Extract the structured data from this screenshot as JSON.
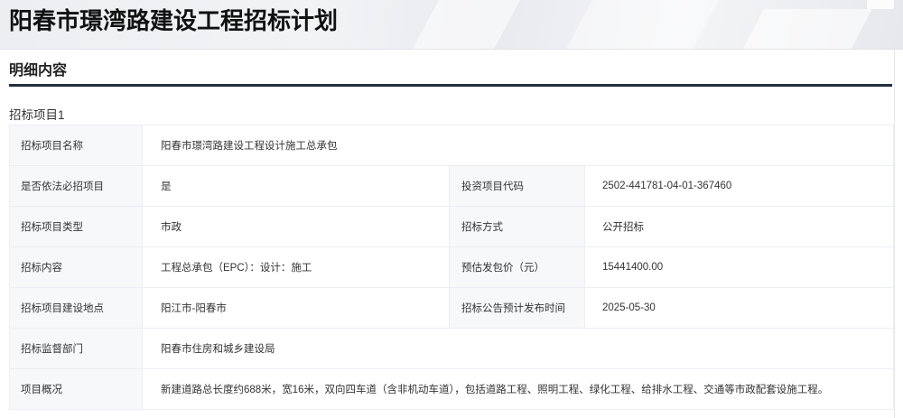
{
  "page": {
    "title": "阳春市璟湾路建设工程招标计划"
  },
  "section": {
    "heading": "明细内容"
  },
  "project": {
    "label": "招标项目1",
    "rows": [
      {
        "label": "招标项目名称",
        "value": "阳春市璟湾路建设工程设计施工总承包"
      },
      {
        "label": "是否依法必招项目",
        "value": "是",
        "label2": "投资项目代码",
        "value2": "2502-441781-04-01-367460"
      },
      {
        "label": "招标项目类型",
        "value": "市政",
        "label2": "招标方式",
        "value2": "公开招标"
      },
      {
        "label": "招标内容",
        "value": "工程总承包（EPC）：设计：施工",
        "label2": "预估发包价（元）",
        "value2": "15441400.00"
      },
      {
        "label": "招标项目建设地点",
        "value": "阳江市-阳春市",
        "label2": "招标公告预计发布时间",
        "value2": "2025-05-30"
      },
      {
        "label": "招标监督部门",
        "value": "阳春市住房和城乡建设局"
      },
      {
        "label": "项目概况",
        "value": "新建道路总长度约688米，宽16米，双向四车道（含非机动车道），包括道路工程、照明工程、绿化工程、给排水工程、交通等市政配套设施工程。"
      }
    ]
  }
}
